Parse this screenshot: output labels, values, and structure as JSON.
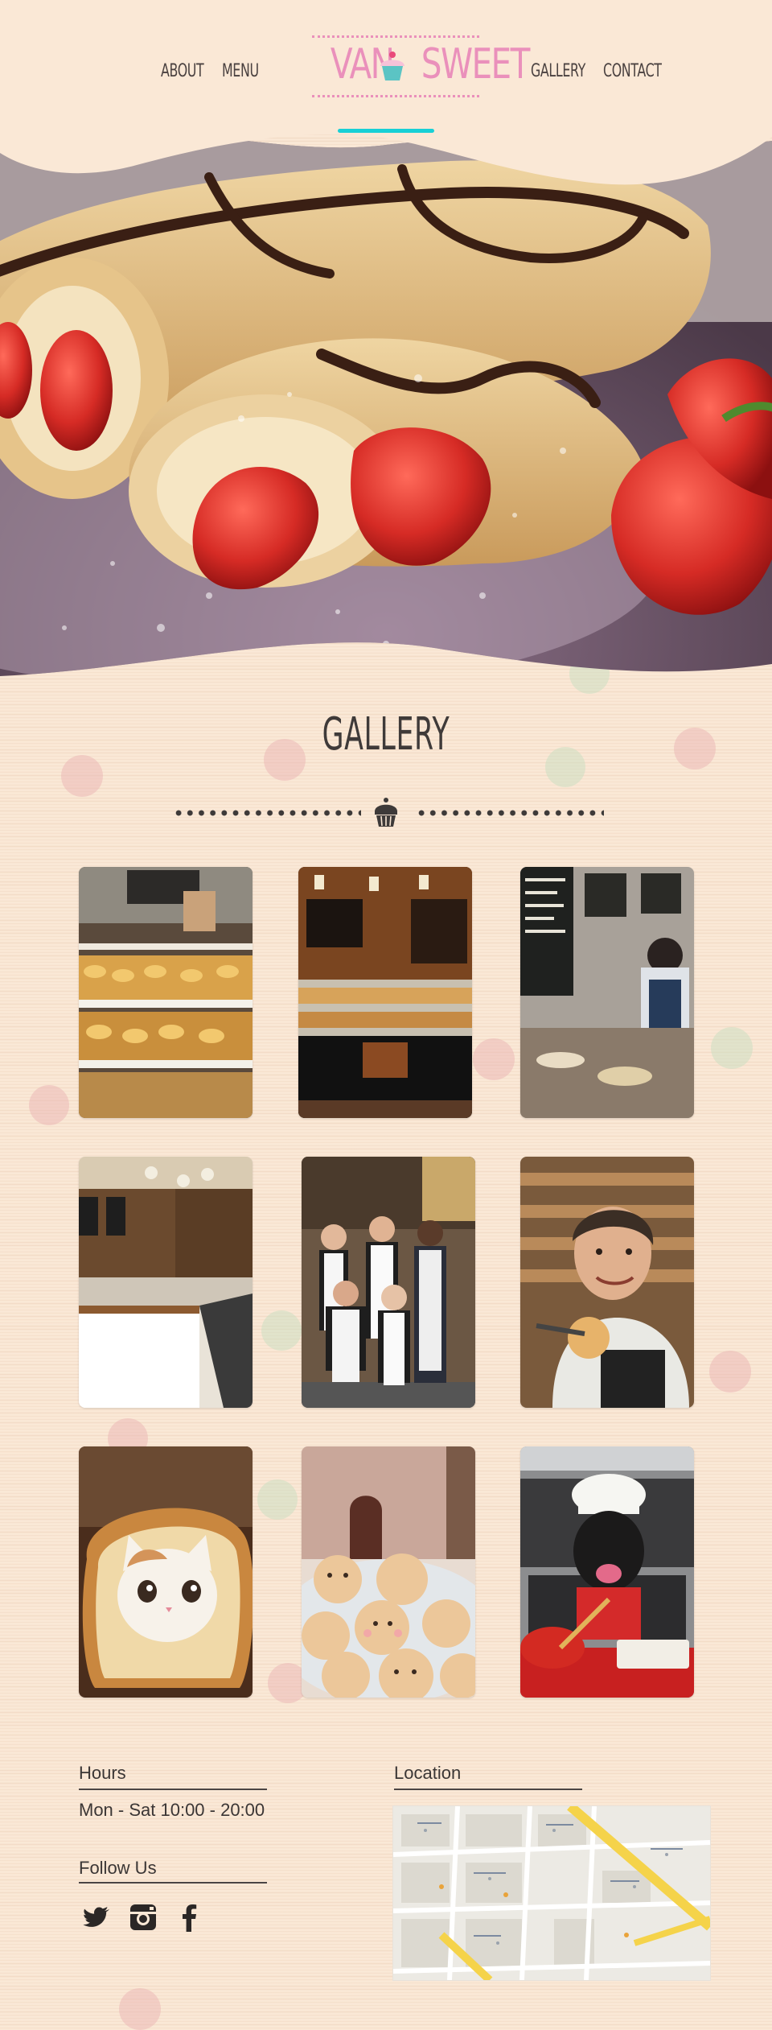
{
  "brand": {
    "name": "VAN SWEET",
    "logo_left": "VAN",
    "logo_right": "SWEET",
    "accent_pink": "#ea90bb",
    "accent_cyan": "#18d0d6",
    "background": "#fae8d6"
  },
  "nav": {
    "left": [
      {
        "label": "ABOUT"
      },
      {
        "label": "MENU"
      }
    ],
    "right": [
      {
        "label": "GALLERY"
      },
      {
        "label": "CONTACT"
      }
    ]
  },
  "hero": {
    "image": "crepes-with-strawberries-and-chocolate"
  },
  "gallery": {
    "title": "GALLERY",
    "divider_icon": "cupcake-icon",
    "photos": [
      {
        "image": "bakery-display-case"
      },
      {
        "image": "bakery-counter-interior"
      },
      {
        "image": "baker-behind-counter"
      },
      {
        "image": "bright-cafe-interior"
      },
      {
        "image": "bakery-staff-group"
      },
      {
        "image": "smiling-baker-with-bun"
      },
      {
        "image": "cat-in-bread-slice"
      },
      {
        "image": "animal-shaped-buns"
      },
      {
        "image": "dog-in-chef-hat-baking"
      }
    ]
  },
  "footer": {
    "hours": {
      "heading": "Hours",
      "text": "Mon - Sat  10:00 - 20:00"
    },
    "follow": {
      "heading": "Follow Us",
      "icons": [
        "twitter-icon",
        "instagram-icon",
        "facebook-icon"
      ]
    },
    "location": {
      "heading": "Location",
      "map": "street-map"
    }
  }
}
